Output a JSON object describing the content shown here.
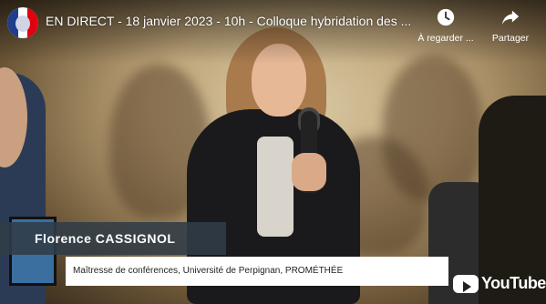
{
  "video": {
    "title": "EN DIRECT - 18 janvier 2023 - 10h - Colloque hybridation des ..."
  },
  "actions": {
    "watch_later_label": "À regarder ...",
    "share_label": "Partager"
  },
  "lower_third": {
    "name": "Florence CASSIGNOL",
    "role": "Maîtresse de conférences,  Université de Perpignan, PROMÉTHÉE"
  },
  "branding": {
    "youtube_label": "YouTube"
  },
  "icons": {
    "channel": "marianne-logo-icon",
    "watch_later": "clock-icon",
    "share": "share-arrow-icon",
    "youtube": "youtube-play-icon"
  },
  "colors": {
    "name_band": "#303c48",
    "role_band": "#ffffff",
    "logo_blue": "#1f3e8c",
    "logo_red": "#e1000f"
  }
}
